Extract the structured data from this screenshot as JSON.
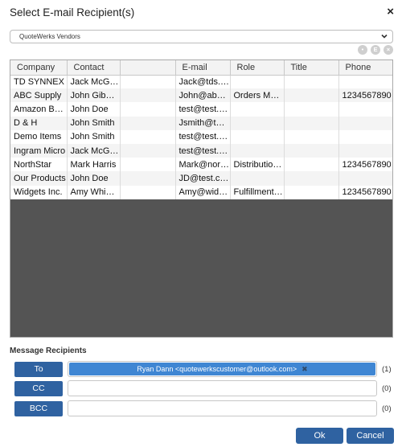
{
  "dialog": {
    "title": "Select E-mail Recipient(s)",
    "close_glyph": "×"
  },
  "source_select": {
    "selected": "QuoteWerks Vendors"
  },
  "grid_tools": [
    {
      "icon": "contact-circle-icon",
      "glyph": "•"
    },
    {
      "icon": "edit-circle-icon",
      "glyph": "E"
    },
    {
      "icon": "clear-circle-icon",
      "glyph": "×"
    }
  ],
  "contacts_table": {
    "columns": [
      "Company",
      "Contact",
      "",
      "E-mail",
      "Role",
      "Title",
      "Phone"
    ],
    "rows": [
      [
        "TD SYNNEX",
        "Jack McGa…",
        "",
        "Jack@tds.c…",
        "",
        "",
        ""
      ],
      [
        "ABC Supply",
        "John Gibbons",
        "",
        "John@abc.…",
        "Orders Man…",
        "",
        "1234567890"
      ],
      [
        "Amazon Bu…",
        "John Doe",
        "",
        "test@test.c…",
        "",
        "",
        ""
      ],
      [
        "D & H",
        "John Smith",
        "",
        "Jsmith@tes…",
        "",
        "",
        ""
      ],
      [
        "Demo Items",
        "John Smith",
        "",
        "test@test.c…",
        "",
        "",
        ""
      ],
      [
        "Ingram Micro",
        "Jack McGa…",
        "",
        "test@test.c…",
        "",
        "",
        ""
      ],
      [
        "NorthStar",
        "Mark Harris",
        "",
        "Mark@nort…",
        "Distribution …",
        "",
        "1234567890"
      ],
      [
        "Our Products",
        "John Doe",
        "",
        "JD@test.com",
        "",
        "",
        ""
      ],
      [
        "Widgets Inc.",
        "Amy Whipple",
        "",
        "Amy@widg…",
        "Fulfillment …",
        "",
        "1234567890"
      ]
    ]
  },
  "recipients": {
    "heading": "Message Recipients",
    "to": {
      "label": "To",
      "count": "(1)",
      "chip": "Ryan Dann <quotewerkscustomer@outlook.com>",
      "chip_remove": "✖"
    },
    "cc": {
      "label": "CC",
      "count": "(0)"
    },
    "bcc": {
      "label": "BCC",
      "count": "(0)"
    }
  },
  "footer": {
    "ok_label": "Ok",
    "cancel_label": "Cancel"
  },
  "colors": {
    "primary_button": "#2f62a1",
    "chip": "#3f86d3",
    "grid_empty": "#545454"
  }
}
